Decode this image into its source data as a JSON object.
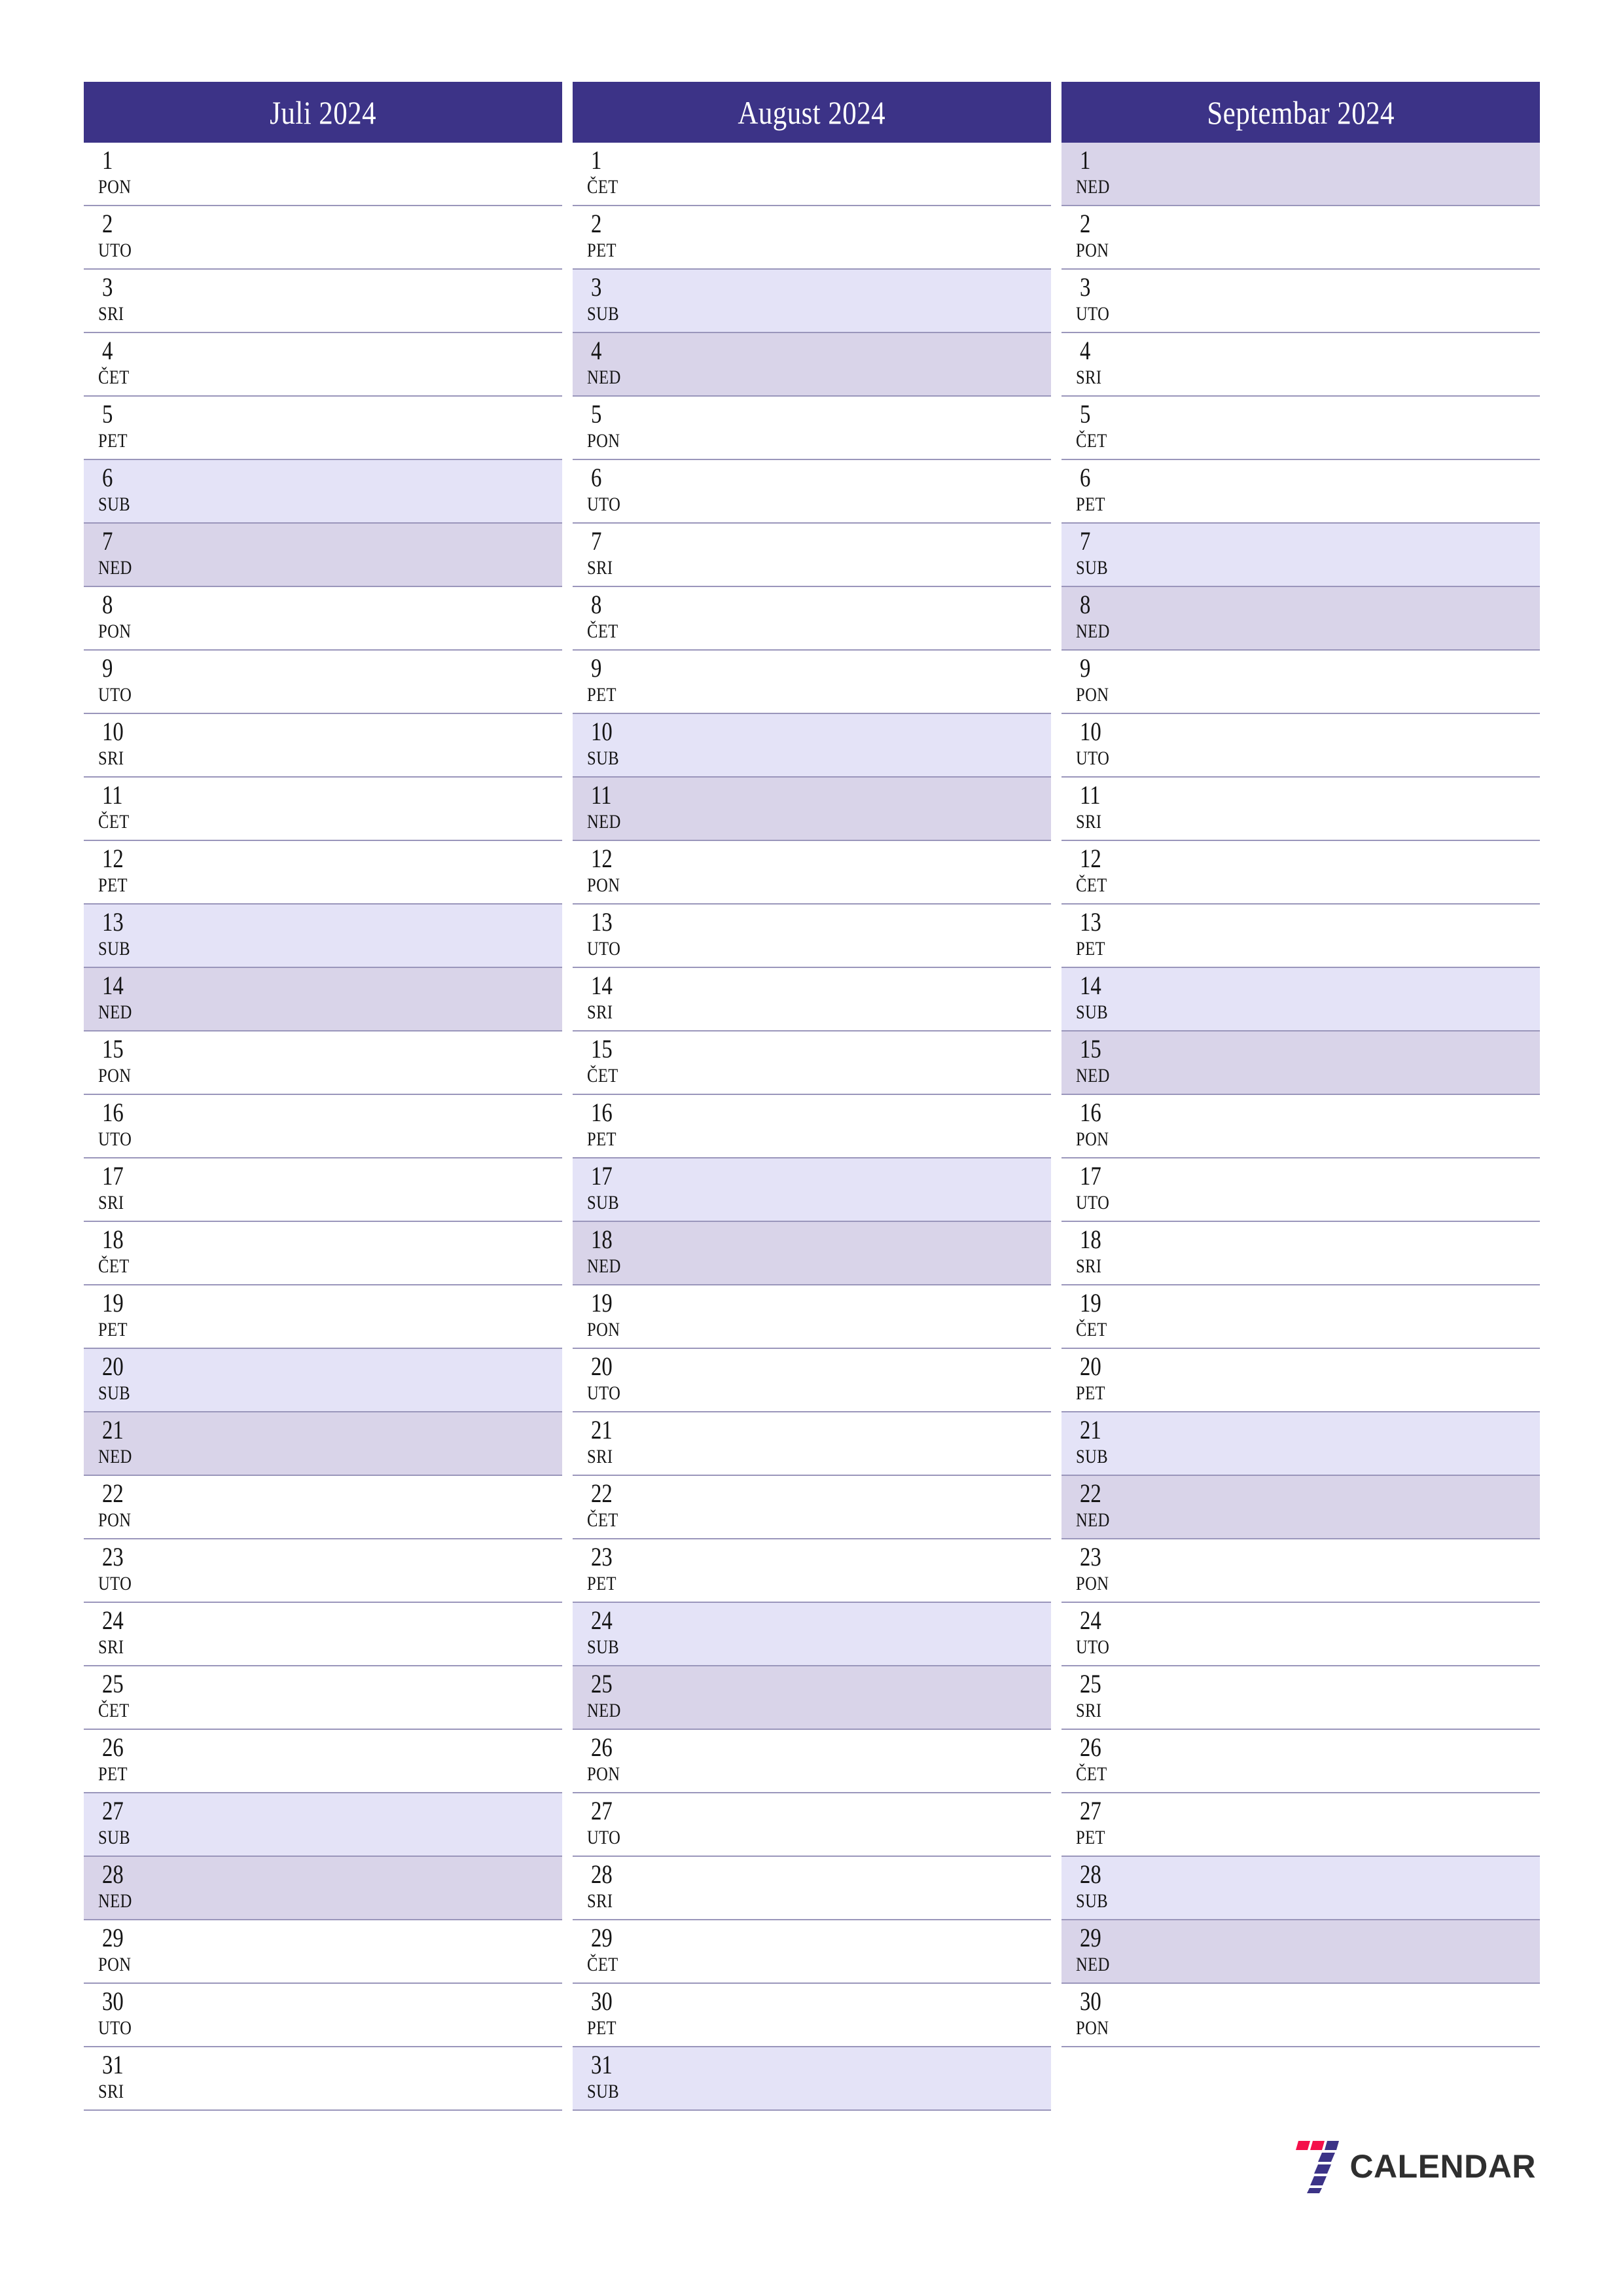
{
  "document": {
    "type": "quarterly-calendar-planner",
    "language_labels": {
      "monday": "PON",
      "tuesday": "UTO",
      "wednesday": "SRI",
      "thursday": "ČET",
      "friday": "PET",
      "saturday": "SUB",
      "sunday": "NED"
    }
  },
  "colors": {
    "header_bg": "#3c3387",
    "header_text": "#ffffff",
    "divider": "#9a96bb",
    "saturday_bg": "#e4e3f7",
    "sunday_bg": "#d9d4e9",
    "page_bg": "#ffffff",
    "day_text": "#141414",
    "logo_red": "#f4104a",
    "logo_blue": "#3c3387",
    "logo_word": "#2f2f2f"
  },
  "months": [
    {
      "id": "july",
      "title": "Juli 2024",
      "days": [
        {
          "num": "1",
          "wd": "PON",
          "type": "weekday"
        },
        {
          "num": "2",
          "wd": "UTO",
          "type": "weekday"
        },
        {
          "num": "3",
          "wd": "SRI",
          "type": "weekday"
        },
        {
          "num": "4",
          "wd": "ČET",
          "type": "weekday"
        },
        {
          "num": "5",
          "wd": "PET",
          "type": "weekday"
        },
        {
          "num": "6",
          "wd": "SUB",
          "type": "sat"
        },
        {
          "num": "7",
          "wd": "NED",
          "type": "sun"
        },
        {
          "num": "8",
          "wd": "PON",
          "type": "weekday"
        },
        {
          "num": "9",
          "wd": "UTO",
          "type": "weekday"
        },
        {
          "num": "10",
          "wd": "SRI",
          "type": "weekday"
        },
        {
          "num": "11",
          "wd": "ČET",
          "type": "weekday"
        },
        {
          "num": "12",
          "wd": "PET",
          "type": "weekday"
        },
        {
          "num": "13",
          "wd": "SUB",
          "type": "sat"
        },
        {
          "num": "14",
          "wd": "NED",
          "type": "sun"
        },
        {
          "num": "15",
          "wd": "PON",
          "type": "weekday"
        },
        {
          "num": "16",
          "wd": "UTO",
          "type": "weekday"
        },
        {
          "num": "17",
          "wd": "SRI",
          "type": "weekday"
        },
        {
          "num": "18",
          "wd": "ČET",
          "type": "weekday"
        },
        {
          "num": "19",
          "wd": "PET",
          "type": "weekday"
        },
        {
          "num": "20",
          "wd": "SUB",
          "type": "sat"
        },
        {
          "num": "21",
          "wd": "NED",
          "type": "sun"
        },
        {
          "num": "22",
          "wd": "PON",
          "type": "weekday"
        },
        {
          "num": "23",
          "wd": "UTO",
          "type": "weekday"
        },
        {
          "num": "24",
          "wd": "SRI",
          "type": "weekday"
        },
        {
          "num": "25",
          "wd": "ČET",
          "type": "weekday"
        },
        {
          "num": "26",
          "wd": "PET",
          "type": "weekday"
        },
        {
          "num": "27",
          "wd": "SUB",
          "type": "sat"
        },
        {
          "num": "28",
          "wd": "NED",
          "type": "sun"
        },
        {
          "num": "29",
          "wd": "PON",
          "type": "weekday"
        },
        {
          "num": "30",
          "wd": "UTO",
          "type": "weekday"
        },
        {
          "num": "31",
          "wd": "SRI",
          "type": "weekday"
        }
      ]
    },
    {
      "id": "august",
      "title": "August 2024",
      "days": [
        {
          "num": "1",
          "wd": "ČET",
          "type": "weekday"
        },
        {
          "num": "2",
          "wd": "PET",
          "type": "weekday"
        },
        {
          "num": "3",
          "wd": "SUB",
          "type": "sat"
        },
        {
          "num": "4",
          "wd": "NED",
          "type": "sun"
        },
        {
          "num": "5",
          "wd": "PON",
          "type": "weekday"
        },
        {
          "num": "6",
          "wd": "UTO",
          "type": "weekday"
        },
        {
          "num": "7",
          "wd": "SRI",
          "type": "weekday"
        },
        {
          "num": "8",
          "wd": "ČET",
          "type": "weekday"
        },
        {
          "num": "9",
          "wd": "PET",
          "type": "weekday"
        },
        {
          "num": "10",
          "wd": "SUB",
          "type": "sat"
        },
        {
          "num": "11",
          "wd": "NED",
          "type": "sun"
        },
        {
          "num": "12",
          "wd": "PON",
          "type": "weekday"
        },
        {
          "num": "13",
          "wd": "UTO",
          "type": "weekday"
        },
        {
          "num": "14",
          "wd": "SRI",
          "type": "weekday"
        },
        {
          "num": "15",
          "wd": "ČET",
          "type": "weekday"
        },
        {
          "num": "16",
          "wd": "PET",
          "type": "weekday"
        },
        {
          "num": "17",
          "wd": "SUB",
          "type": "sat"
        },
        {
          "num": "18",
          "wd": "NED",
          "type": "sun"
        },
        {
          "num": "19",
          "wd": "PON",
          "type": "weekday"
        },
        {
          "num": "20",
          "wd": "UTO",
          "type": "weekday"
        },
        {
          "num": "21",
          "wd": "SRI",
          "type": "weekday"
        },
        {
          "num": "22",
          "wd": "ČET",
          "type": "weekday"
        },
        {
          "num": "23",
          "wd": "PET",
          "type": "weekday"
        },
        {
          "num": "24",
          "wd": "SUB",
          "type": "sat"
        },
        {
          "num": "25",
          "wd": "NED",
          "type": "sun"
        },
        {
          "num": "26",
          "wd": "PON",
          "type": "weekday"
        },
        {
          "num": "27",
          "wd": "UTO",
          "type": "weekday"
        },
        {
          "num": "28",
          "wd": "SRI",
          "type": "weekday"
        },
        {
          "num": "29",
          "wd": "ČET",
          "type": "weekday"
        },
        {
          "num": "30",
          "wd": "PET",
          "type": "weekday"
        },
        {
          "num": "31",
          "wd": "SUB",
          "type": "sat"
        }
      ]
    },
    {
      "id": "september",
      "title": "Septembar 2024",
      "days": [
        {
          "num": "1",
          "wd": "NED",
          "type": "sun"
        },
        {
          "num": "2",
          "wd": "PON",
          "type": "weekday"
        },
        {
          "num": "3",
          "wd": "UTO",
          "type": "weekday"
        },
        {
          "num": "4",
          "wd": "SRI",
          "type": "weekday"
        },
        {
          "num": "5",
          "wd": "ČET",
          "type": "weekday"
        },
        {
          "num": "6",
          "wd": "PET",
          "type": "weekday"
        },
        {
          "num": "7",
          "wd": "SUB",
          "type": "sat"
        },
        {
          "num": "8",
          "wd": "NED",
          "type": "sun"
        },
        {
          "num": "9",
          "wd": "PON",
          "type": "weekday"
        },
        {
          "num": "10",
          "wd": "UTO",
          "type": "weekday"
        },
        {
          "num": "11",
          "wd": "SRI",
          "type": "weekday"
        },
        {
          "num": "12",
          "wd": "ČET",
          "type": "weekday"
        },
        {
          "num": "13",
          "wd": "PET",
          "type": "weekday"
        },
        {
          "num": "14",
          "wd": "SUB",
          "type": "sat"
        },
        {
          "num": "15",
          "wd": "NED",
          "type": "sun"
        },
        {
          "num": "16",
          "wd": "PON",
          "type": "weekday"
        },
        {
          "num": "17",
          "wd": "UTO",
          "type": "weekday"
        },
        {
          "num": "18",
          "wd": "SRI",
          "type": "weekday"
        },
        {
          "num": "19",
          "wd": "ČET",
          "type": "weekday"
        },
        {
          "num": "20",
          "wd": "PET",
          "type": "weekday"
        },
        {
          "num": "21",
          "wd": "SUB",
          "type": "sat"
        },
        {
          "num": "22",
          "wd": "NED",
          "type": "sun"
        },
        {
          "num": "23",
          "wd": "PON",
          "type": "weekday"
        },
        {
          "num": "24",
          "wd": "UTO",
          "type": "weekday"
        },
        {
          "num": "25",
          "wd": "SRI",
          "type": "weekday"
        },
        {
          "num": "26",
          "wd": "ČET",
          "type": "weekday"
        },
        {
          "num": "27",
          "wd": "PET",
          "type": "weekday"
        },
        {
          "num": "28",
          "wd": "SUB",
          "type": "sat"
        },
        {
          "num": "29",
          "wd": "NED",
          "type": "sun"
        },
        {
          "num": "30",
          "wd": "PON",
          "type": "weekday"
        }
      ]
    }
  ],
  "footer": {
    "logo_text": "CALENDAR",
    "logo_icon": "seven-logo-icon"
  }
}
